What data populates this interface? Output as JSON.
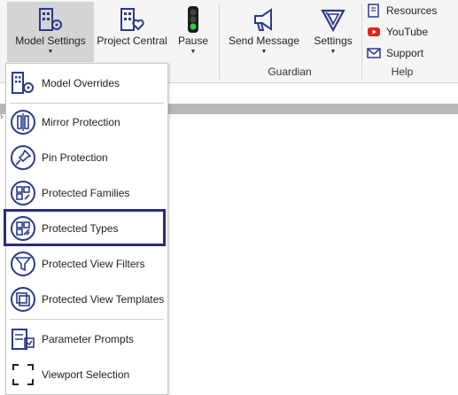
{
  "ribbon": {
    "model_settings": "Model Settings",
    "project_central": "Project Central",
    "pause": "Pause",
    "send_message": "Send Message",
    "settings": "Settings",
    "guardian_group": "Guardian",
    "help_group": "Help",
    "resources": "Resources",
    "youtube": "YouTube",
    "support": "Support"
  },
  "menu": {
    "items": [
      {
        "label": "Model Overrides",
        "icon": "model-overrides-icon"
      },
      {
        "label": "Mirror Protection",
        "icon": "mirror-protection-icon"
      },
      {
        "label": "Pin Protection",
        "icon": "pin-icon"
      },
      {
        "label": "Protected Families",
        "icon": "protected-families-icon"
      },
      {
        "label": "Protected Types",
        "icon": "protected-types-icon"
      },
      {
        "label": "Protected View Filters",
        "icon": "filter-icon"
      },
      {
        "label": "Protected View Templates",
        "icon": "view-templates-icon"
      },
      {
        "label": "Parameter Prompts",
        "icon": "parameter-prompts-icon"
      },
      {
        "label": "Viewport Selection",
        "icon": "viewport-selection-icon"
      }
    ],
    "highlighted_item": "Protected Types"
  },
  "colors": {
    "accent_navy": "#2c2c7a",
    "icon_navy": "#2b3a8c",
    "youtube_red": "#e62117",
    "pause_green": "#2ecc40"
  }
}
